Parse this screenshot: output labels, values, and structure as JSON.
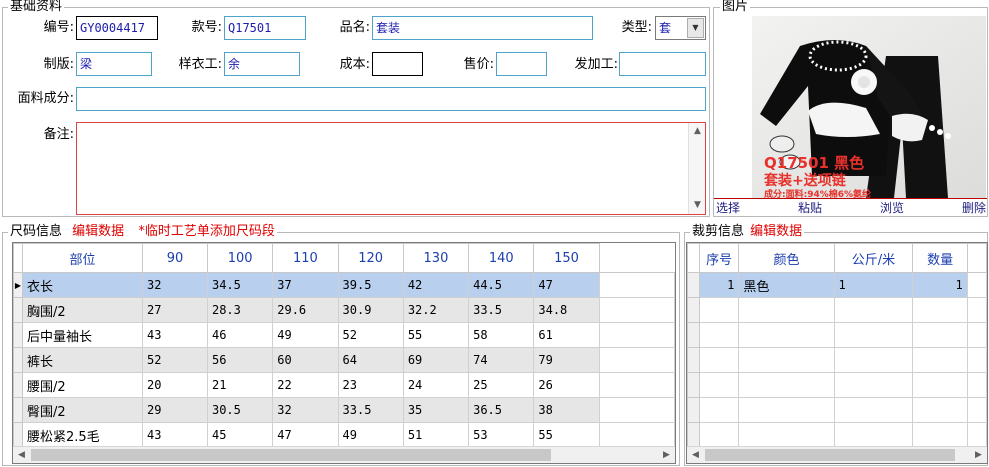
{
  "basic": {
    "title": "基础资料",
    "labels": {
      "code": "编号:",
      "style_no": "款号:",
      "product_name": "品名:",
      "type": "类型:",
      "plate": "制版:",
      "sample_worker": "样衣工:",
      "cost": "成本:",
      "price": "售价:",
      "processor": "发加工:",
      "fabric": "面料成分:",
      "remark": "备注:"
    },
    "values": {
      "code": "GY0004417",
      "style_no": "Q17501",
      "product_name": "套装",
      "type": "套",
      "plate": "梁",
      "sample_worker": "余",
      "cost": "",
      "price": "",
      "processor": "",
      "fabric": "",
      "remark": ""
    }
  },
  "picture": {
    "title": "图片",
    "photo_text": {
      "line1": "Q17501  黑色",
      "line2": "套装+送项链",
      "line3": "成分:面料:94%棉6%氨纶"
    },
    "actions": [
      "选择",
      "粘贴",
      "浏览",
      "删除"
    ]
  },
  "size_info": {
    "title": "尺码信息",
    "edit_link": "编辑数据",
    "note": "*临时工艺单添加尺码段",
    "columns": [
      "部位",
      "90",
      "100",
      "110",
      "120",
      "130",
      "140",
      "150"
    ],
    "rows": [
      [
        "衣长",
        "32",
        "34.5",
        "37",
        "39.5",
        "42",
        "44.5",
        "47"
      ],
      [
        "胸围/2",
        "27",
        "28.3",
        "29.6",
        "30.9",
        "32.2",
        "33.5",
        "34.8"
      ],
      [
        "后中量袖长",
        "43",
        "46",
        "49",
        "52",
        "55",
        "58",
        "61"
      ],
      [
        "裤长",
        "52",
        "56",
        "60",
        "64",
        "69",
        "74",
        "79"
      ],
      [
        "腰围/2",
        "20",
        "21",
        "22",
        "23",
        "24",
        "25",
        "26"
      ],
      [
        "臀围/2",
        "29",
        "30.5",
        "32",
        "33.5",
        "35",
        "36.5",
        "38"
      ],
      [
        "腰松紧2.5毛",
        "43",
        "45",
        "47",
        "49",
        "51",
        "53",
        "55"
      ]
    ]
  },
  "cut_info": {
    "title": "裁剪信息",
    "edit_link": "编辑数据",
    "columns": [
      "序号",
      "颜色",
      "公斤/米",
      "数量"
    ],
    "rows": [
      [
        "1",
        "黑色",
        "1",
        "1"
      ]
    ]
  },
  "colors": {
    "accent_blue": "#1c3fb0",
    "red": "#e00000",
    "selected_row": "#b8d0ee",
    "field_border": "#4fa3c9"
  }
}
